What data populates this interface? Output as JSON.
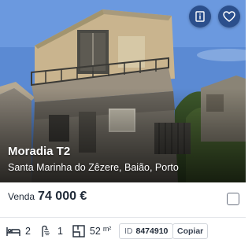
{
  "listing": {
    "title": "Moradia T2",
    "location": "Santa Marinha do Zêzere, Baião, Porto",
    "price_label": "Venda",
    "price": "74 000 €",
    "bedrooms": "2",
    "bathrooms": "1",
    "area": "52",
    "area_unit": "m²",
    "id_label": "ID",
    "id_value": "8474910",
    "copy_label": "Copiar"
  },
  "icons": {
    "info": "document-info-icon",
    "favorite": "heart-icon",
    "bed": "bed-icon",
    "bath": "shower-icon",
    "area": "floor-plan-icon"
  },
  "colors": {
    "action_button": "#2b4f8c",
    "text": "#1f2937",
    "border": "#d1d5db",
    "sky": "#5f8fd6"
  }
}
